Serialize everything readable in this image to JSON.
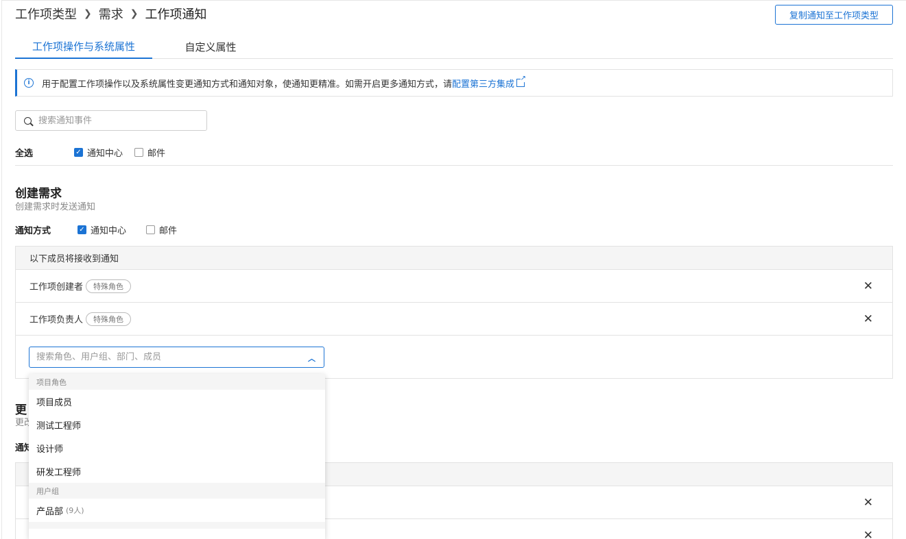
{
  "breadcrumb": {
    "items": [
      "工作项类型",
      "需求",
      "工作项通知"
    ]
  },
  "header": {
    "copy_button": "复制通知至工作项类型"
  },
  "tabs": [
    {
      "label": "工作项操作与系统属性",
      "active": true
    },
    {
      "label": "自定义属性",
      "active": false
    }
  ],
  "info": {
    "text": "用于配置工作项操作以及系统属性变更通知方式和通知对象，使通知更精准。如需开启更多通知方式，请",
    "link": "配置第三方集成"
  },
  "search": {
    "placeholder": "搜索通知事件"
  },
  "select_all": {
    "label": "全选",
    "options": [
      {
        "label": "通知中心",
        "checked": true
      },
      {
        "label": "邮件",
        "checked": false
      }
    ]
  },
  "section1": {
    "title": "创建需求",
    "subtitle": "创建需求时发送通知",
    "method_label": "通知方式",
    "methods": [
      {
        "label": "通知中心",
        "checked": true
      },
      {
        "label": "邮件",
        "checked": false
      }
    ],
    "panel_header": "以下成员将接收到通知",
    "members": [
      {
        "name": "工作项创建者",
        "tag": "特殊角色"
      },
      {
        "name": "工作项负责人",
        "tag": "特殊角色"
      }
    ],
    "picker_placeholder": "搜索角色、用户组、部门、成员"
  },
  "section2": {
    "title_partial": "更",
    "subtitle_partial": "更改",
    "method_label_partial": "通知"
  },
  "dropdown": {
    "groups": [
      {
        "label": "项目角色",
        "items": [
          "项目成员",
          "测试工程师",
          "设计师",
          "研发工程师"
        ]
      },
      {
        "label": "用户组",
        "items": [
          {
            "name": "产品部",
            "count": "(9人)"
          }
        ]
      }
    ]
  },
  "colors": {
    "accent": "#1b73d4",
    "border": "#e2e2e2",
    "panel_bg": "#f5f5f5"
  },
  "icons": [
    "chevron-right-icon",
    "info-icon",
    "external-link-icon",
    "search-icon",
    "close-icon",
    "chevron-up-icon",
    "check-icon"
  ]
}
